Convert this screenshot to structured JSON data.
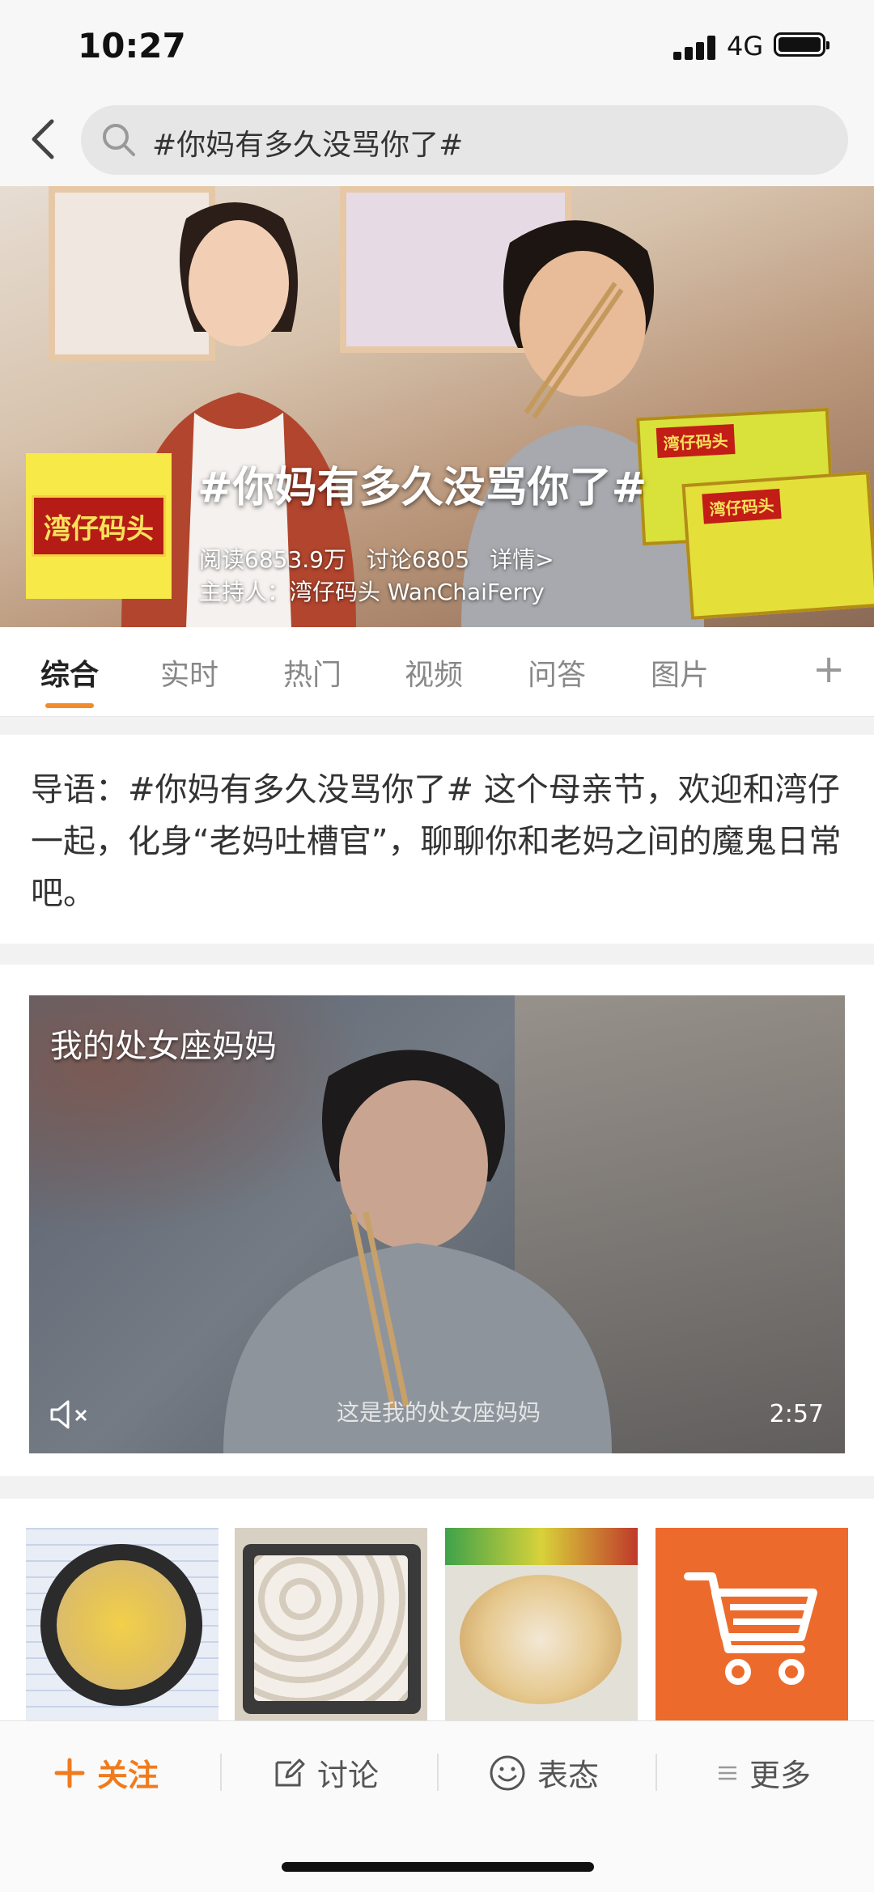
{
  "status_bar": {
    "time": "10:27",
    "network": "4G"
  },
  "search": {
    "query": "#你妈有多久没骂你了#"
  },
  "banner": {
    "title": "#你妈有多久没骂你了#",
    "reads": "阅读6853.9万",
    "discussions": "讨论6805",
    "details": "详情>",
    "host": "主持人：湾仔码头 WanChaiFerry",
    "logo_text": "湾仔码头",
    "pack_label": "湾仔码头"
  },
  "tabs": [
    "综合",
    "实时",
    "热门",
    "视频",
    "问答",
    "图片"
  ],
  "intro": {
    "text": "导语：#你妈有多久没骂你了# 这个母亲节，欢迎和湾仔一起，化身“老妈吐槽官”，聊聊你和老妈之间的魔鬼日常吧。"
  },
  "video": {
    "title": "我的处女座妈妈",
    "subtitle": "这是我的处女座妈妈",
    "duration": "2:57"
  },
  "bottom_bar": {
    "follow": "关注",
    "discuss": "讨论",
    "express": "表态",
    "more": "更多"
  },
  "colors": {
    "accent": "#f28b2a",
    "follow": "#f07b1d",
    "cart_tile": "#ec6b2c"
  },
  "icons": [
    "back-icon",
    "search-icon",
    "mute-icon",
    "cart-icon",
    "plus-icon",
    "edit-icon",
    "smile-icon",
    "menu-icon"
  ]
}
